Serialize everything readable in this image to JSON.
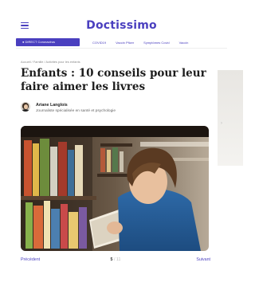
{
  "header": {
    "logo": "Doctissimo",
    "menu_icon": "hamburger-menu-icon"
  },
  "nav": {
    "live_label": "● DIRECT Coronavirus",
    "links": [
      "COVID19",
      "Vaccin Pfizer",
      "Symptômes Covid",
      "Vaccin"
    ],
    "scroll_icon": "chevron-right-icon"
  },
  "breadcrumb": "Accueil / Famille / Activités pour les enfants",
  "article": {
    "title": "Enfants : 10 conseils pour leur faire aimer les livres",
    "author_name": "Ariane Langlois",
    "author_role": "Journaliste spécialisée en santé et psychologie"
  },
  "pager": {
    "prev": "Précédent",
    "current": "5",
    "total": "/ 11",
    "next": "Suivant"
  },
  "colors": {
    "brand": "#4a3fbf"
  }
}
